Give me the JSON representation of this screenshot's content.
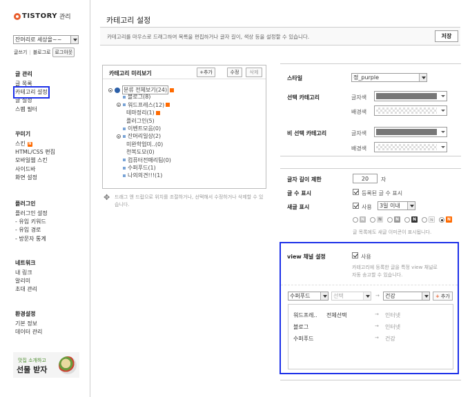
{
  "app": {
    "logo": "TISTORY",
    "logo_sub": "관리"
  },
  "sidebar": {
    "blog_select": "잔머리로 세상을~~",
    "links": [
      "글쓰기",
      "블로그로"
    ],
    "logout": "로그아웃",
    "groups": [
      {
        "title": "글 관리",
        "items": [
          {
            "label": "글 목록"
          },
          {
            "label": "카테고리 설정",
            "active": true
          },
          {
            "label": "글 설정"
          },
          {
            "label": "스팸 필터"
          }
        ]
      },
      {
        "title": "꾸미기",
        "items": [
          {
            "label": "스킨",
            "badge": "N"
          },
          {
            "label": "HTML/CSS 편집"
          },
          {
            "label": "모바일웹 스킨"
          },
          {
            "label": "사이드바"
          },
          {
            "label": "화면 설정"
          }
        ]
      },
      {
        "title": "플러그인",
        "items": [
          {
            "label": "플러그인 설정"
          },
          {
            "label": "- 유입 키워드"
          },
          {
            "label": "- 유입 경로"
          },
          {
            "label": "- 방문자 통계"
          }
        ]
      },
      {
        "title": "네트워크",
        "items": [
          {
            "label": "내 링크"
          },
          {
            "label": "알리미"
          },
          {
            "label": "초대 관리"
          }
        ]
      },
      {
        "title": "환경설정",
        "items": [
          {
            "label": "기본 정보"
          },
          {
            "label": "데이터 관리"
          }
        ]
      }
    ],
    "ad": {
      "small": "맛집 소개하고",
      "big": "선물 받자"
    }
  },
  "main": {
    "title": "카테고리 설정",
    "description": "카테고리를 마우스로 드래그하여 목록을 편집하거나 글자 길이, 색상 등을 설정할 수 있습니다.",
    "save": "저장",
    "preview": {
      "title": "카테고리 미리보기",
      "add": "+추가",
      "edit": "수정",
      "delete": "삭제",
      "tree": [
        {
          "label": "분류 전체보기(24)",
          "level": 0,
          "root": true,
          "badge": true
        },
        {
          "label": "블로그(8)",
          "level": 1
        },
        {
          "label": "워드프레스(12)",
          "level": 1,
          "toggle": true,
          "badge": true
        },
        {
          "label": "테마정리(1)",
          "level": 2,
          "badge": true
        },
        {
          "label": "플러그인(5)",
          "level": 2
        },
        {
          "label": "이벤트모음(0)",
          "level": 1
        },
        {
          "label": "잔머리일상(2)",
          "level": 1,
          "toggle": true
        },
        {
          "label": "미완학업미..(0)",
          "level": 2
        },
        {
          "label": "천복도모(0)",
          "level": 2
        },
        {
          "label": "컴퓨터전매리팀(0)",
          "level": 1
        },
        {
          "label": "수퍼푸드(1)",
          "level": 1
        },
        {
          "label": "나의의견!!!(1)",
          "level": 1
        }
      ],
      "hint": "드래그 앤 드랍으로 위치를 조절하거나, 선택해서 수정하거나 삭제할 수 있습니다."
    },
    "style": {
      "label": "스타일",
      "value": "정_purple"
    },
    "selected_category": {
      "label": "선택 카테고리",
      "text_color": "글자색",
      "bg_color": "배경색",
      "text_swatch": "#777777"
    },
    "unselected_category": {
      "label": "비 선택 카테고리",
      "text_color": "글자색",
      "bg_color": "배경색",
      "text_swatch": "#777777"
    },
    "length_limit": {
      "label": "글자 길이 제한",
      "value": "20",
      "unit": "자"
    },
    "count_display": {
      "label": "글 수 표시",
      "option": "등록된 글 수 표시"
    },
    "new_display": {
      "label": "새글 표시",
      "use": "사용",
      "period": "3일 이내",
      "icons": [
        "N",
        "N",
        "N",
        "N",
        "N",
        "N"
      ],
      "note": "글 목록에도 새글 이미콘이 표시됩니다."
    },
    "view_channel": {
      "label": "view 채널 설정",
      "use": "사용",
      "desc1": "카테고리에 등록한 글을 특정 view 채널로",
      "desc2": "자동 송고할 수 있습니다.",
      "sel1": "수퍼푸드",
      "sel2": "선택",
      "sel3": "건강",
      "add": "추가",
      "rows": [
        {
          "category": "워드프레..",
          "channel": "전체선택",
          "target": "인터넷"
        },
        {
          "category": "블로그",
          "channel": "",
          "target": "인터넷"
        },
        {
          "category": "수퍼푸드",
          "channel": "",
          "target": "건강"
        }
      ],
      "arrow": "→"
    }
  }
}
